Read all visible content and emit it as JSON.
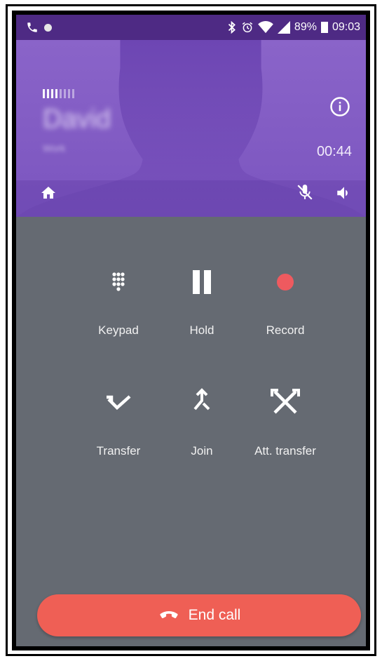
{
  "status_bar": {
    "battery": "89%",
    "time": "09:03",
    "icons": [
      "phone-icon",
      "notification-dot-icon",
      "bluetooth-icon",
      "alarm-icon",
      "wifi-icon",
      "cell-signal-icon",
      "battery-icon"
    ]
  },
  "header": {
    "contact_name": "David",
    "contact_sub": "Work",
    "call_duration": "00:44",
    "signal_strength_fraction": 0.5
  },
  "controls": [
    {
      "label": "Keypad",
      "icon": "keypad-icon"
    },
    {
      "label": "Hold",
      "icon": "pause-icon"
    },
    {
      "label": "Record",
      "icon": "record-icon"
    },
    {
      "label": "Transfer",
      "icon": "transfer-icon"
    },
    {
      "label": "Join",
      "icon": "merge-icon"
    },
    {
      "label": "Att. transfer",
      "icon": "attended-transfer-icon"
    }
  ],
  "end_call": {
    "label": "End call",
    "icon": "hang-up-icon"
  },
  "colors": {
    "status_bar": "#4e2a84",
    "header": "#7f59c4",
    "panel": "#656a72",
    "record_dot": "#ee5a5f",
    "end_call": "#ef5f55"
  }
}
